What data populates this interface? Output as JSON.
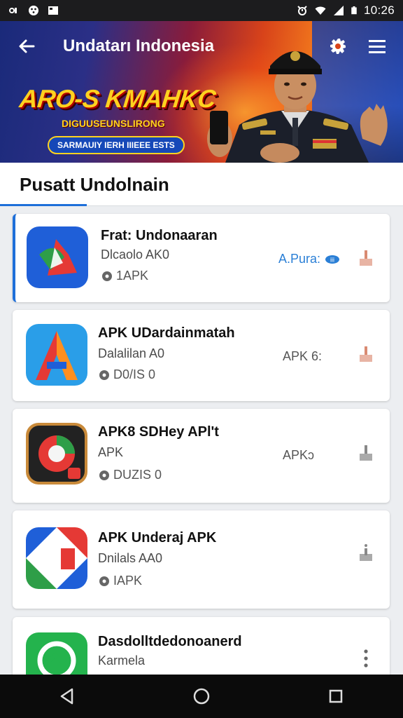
{
  "status_bar": {
    "time": "10:26",
    "icons": [
      "notification-icon",
      "app-icon",
      "image-icon",
      "alarm-icon",
      "wifi-icon",
      "signal-icon",
      "battery-icon"
    ]
  },
  "header": {
    "title": "Undatarı Indonesia",
    "promo_title": "ARO-S KMAHKC",
    "promo_subtitle": "DIGUUSEUNSLIRONG",
    "promo_pill": "SARMAUIY IERH IIIEEE ESTS",
    "colors": {
      "orange": "#f1771d",
      "blue": "#1e3a8a",
      "yellow": "#ffd21f"
    }
  },
  "section": {
    "title": "Pusatt Undolnain"
  },
  "apps": [
    {
      "name": "Frat: Undonaaran",
      "developer": "Dlcaolo AK0",
      "meta": "1APK",
      "tag": "A.Pura:",
      "tag_style": "blue",
      "selected": true
    },
    {
      "name": "APK UDardainmatah",
      "developer": "Dalalilan A0",
      "meta": "D0/IS 0",
      "tag": "APK 6:",
      "tag_style": "gray",
      "selected": false
    },
    {
      "name": "APK8 SDHey APl't",
      "developer": "APK",
      "meta": "DUZIS 0",
      "tag": "APKɔ",
      "tag_style": "gray",
      "selected": false
    },
    {
      "name": "APK Underaj APK",
      "developer": "Dnilals AA0",
      "meta": "IAPK",
      "tag": "",
      "tag_style": "gray",
      "selected": false
    },
    {
      "name": "Dasdolltdedonoanerd",
      "developer": "Karmela",
      "meta": "",
      "tag": "",
      "tag_style": "gray",
      "selected": false
    }
  ],
  "accent": "#1e6fd9"
}
